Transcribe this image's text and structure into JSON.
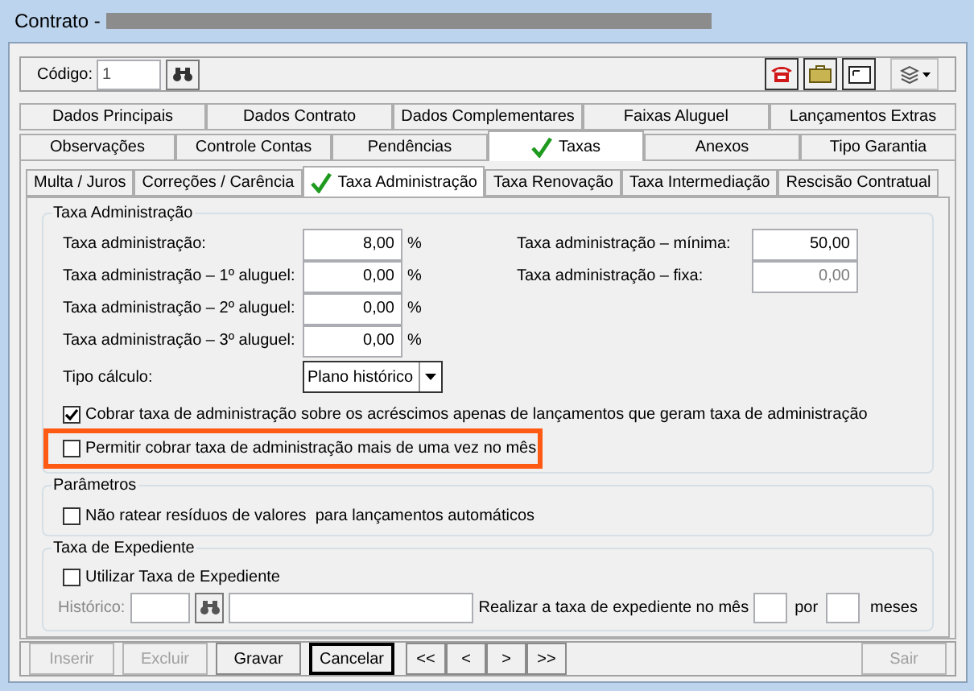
{
  "window": {
    "title": "Contrato -"
  },
  "toolbar": {
    "code_label": "Código:",
    "code_value": "1"
  },
  "tab_rows": [
    [
      {
        "label": "Dados Principais",
        "selected": false,
        "checkmark": false
      },
      {
        "label": "Dados Contrato",
        "selected": false,
        "checkmark": false
      },
      {
        "label": "Dados Complementares",
        "selected": false,
        "checkmark": false
      },
      {
        "label": "Faixas Aluguel",
        "selected": false,
        "checkmark": false
      },
      {
        "label": "Lançamentos Extras",
        "selected": false,
        "checkmark": false
      }
    ],
    [
      {
        "label": "Observações",
        "selected": false,
        "checkmark": false
      },
      {
        "label": "Controle Contas",
        "selected": false,
        "checkmark": false
      },
      {
        "label": "Pendências",
        "selected": false,
        "checkmark": false
      },
      {
        "label": "Taxas",
        "selected": true,
        "checkmark": true
      },
      {
        "label": "Anexos",
        "selected": false,
        "checkmark": false
      },
      {
        "label": "Tipo Garantia",
        "selected": false,
        "checkmark": false
      }
    ]
  ],
  "subtabs": [
    {
      "label": "Multa / Juros",
      "selected": false,
      "checkmark": false
    },
    {
      "label": "Correções / Carência",
      "selected": false,
      "checkmark": false
    },
    {
      "label": "Taxa Administração",
      "selected": true,
      "checkmark": true
    },
    {
      "label": "Taxa Renovação",
      "selected": false,
      "checkmark": false
    },
    {
      "label": "Taxa Intermediação",
      "selected": false,
      "checkmark": false
    },
    {
      "label": "Rescisão Contratual",
      "selected": false,
      "checkmark": false
    }
  ],
  "admin": {
    "title": "Taxa Administração",
    "rates": [
      {
        "label": "Taxa administração:",
        "value": "8,00",
        "unit": "%"
      },
      {
        "label": "Taxa administração – 1º aluguel:",
        "value": "0,00",
        "unit": "%"
      },
      {
        "label": "Taxa administração – 2º aluguel:",
        "value": "0,00",
        "unit": "%"
      },
      {
        "label": "Taxa administração – 3º aluguel:",
        "value": "0,00",
        "unit": "%"
      }
    ],
    "limits": [
      {
        "label": "Taxa administração – mínima:",
        "value": "50,00",
        "disabled": false
      },
      {
        "label": "Taxa administração – fixa:",
        "value": "0,00",
        "disabled": true
      }
    ],
    "calc_label": "Tipo cálculo:",
    "calc_value": "Plano histórico",
    "options": [
      {
        "label": "Cobrar taxa de administração sobre os acréscimos apenas de lançamentos que geram taxa de administração",
        "checked": true,
        "highlighted": false
      },
      {
        "label": "Permitir cobrar taxa de administração mais de uma vez no mês",
        "checked": false,
        "highlighted": true
      }
    ]
  },
  "params": {
    "title": "Parâmetros",
    "options": [
      {
        "label": "Não ratear resíduos de valores  para lançamentos automáticos",
        "checked": false
      }
    ]
  },
  "expediente": {
    "title": "Taxa de Expediente",
    "option": {
      "label": "Utilizar Taxa de Expediente",
      "checked": false
    },
    "history_label": "Histórico:",
    "month_text": "Realizar a taxa de expediente no mês",
    "per_text": "por",
    "months_text": "meses"
  },
  "buttons": [
    {
      "label": "Inserir",
      "disabled": true,
      "focused": false
    },
    {
      "label": "Excluir",
      "disabled": true,
      "focused": false
    },
    {
      "label": "Gravar",
      "disabled": false,
      "focused": false
    },
    {
      "label": "Cancelar",
      "disabled": false,
      "focused": true
    }
  ],
  "nav_buttons": [
    "<<",
    "<",
    ">",
    ">>"
  ],
  "exit_button": {
    "label": "Sair",
    "disabled": true
  }
}
